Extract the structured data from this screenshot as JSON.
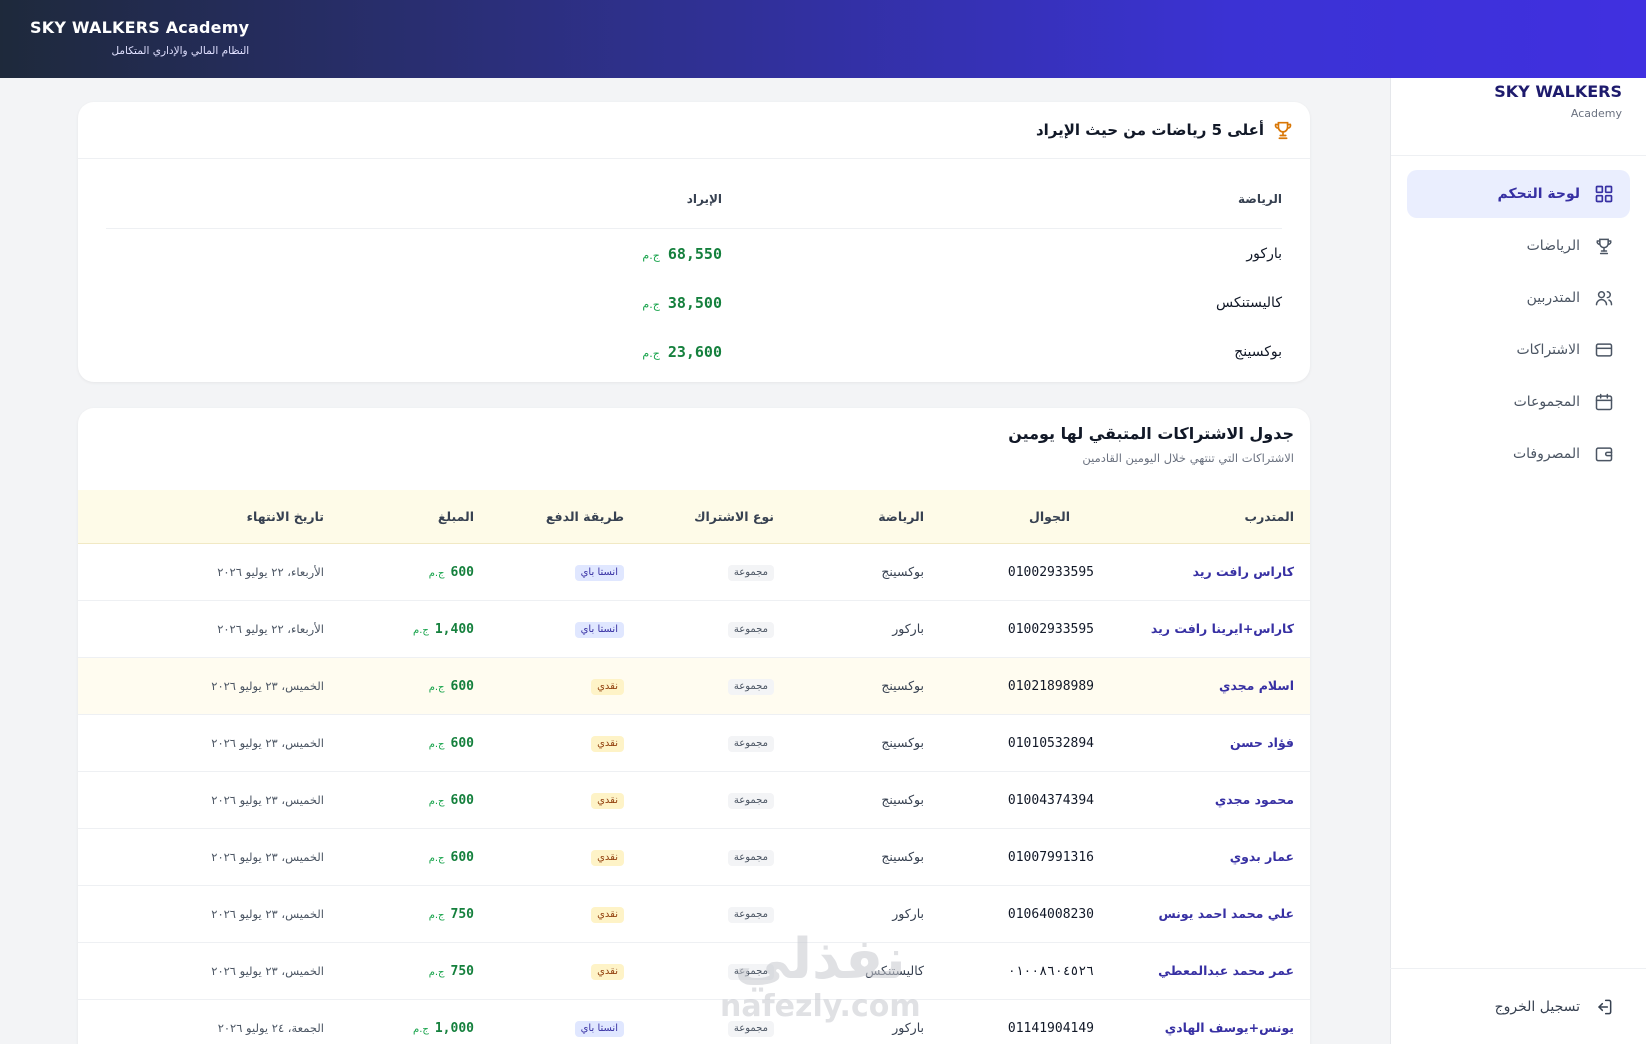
{
  "header": {
    "title": "SKY WALKERS Academy",
    "subtitle": "النظام المالي والإداري المتكامل"
  },
  "sidebar": {
    "brand_title": "SKY WALKERS",
    "brand_sub": "Academy",
    "items": [
      {
        "label": "لوحة التحكم",
        "icon": "grid-icon",
        "active": true
      },
      {
        "label": "الرياضات",
        "icon": "trophy-icon",
        "active": false
      },
      {
        "label": "المتدربين",
        "icon": "users-icon",
        "active": false
      },
      {
        "label": "الاشتراكات",
        "icon": "credit-card-icon",
        "active": false
      },
      {
        "label": "المجموعات",
        "icon": "calendar-icon",
        "active": false
      },
      {
        "label": "المصروفات",
        "icon": "wallet-icon",
        "active": false
      }
    ],
    "logout_label": "تسجيل الخروج"
  },
  "top_sports": {
    "title": "أعلى 5 رياضات من حيث الإيراد",
    "col_sport": "الرياضة",
    "col_revenue": "الإيراد",
    "currency": "ج.م",
    "rows": [
      {
        "sport": "باركور",
        "revenue": "68,550"
      },
      {
        "sport": "كاليستنكس",
        "revenue": "38,500"
      },
      {
        "sport": "بوكسينج",
        "revenue": "23,600"
      }
    ]
  },
  "expiring": {
    "title": "جدول الاشتراكات المتبقي لها يومين",
    "subtitle": "الاشتراكات التي تنتهي خلال اليومين القادمين",
    "columns": {
      "trainee": "المتدرب",
      "phone": "الجوال",
      "sport": "الرياضة",
      "type": "نوع الاشتراك",
      "payment": "طريقة الدفع",
      "amount": "المبلغ",
      "end_date": "تاريخ الانتهاء"
    },
    "currency": "ج.م",
    "rows": [
      {
        "name": "كاراس رافت ريد",
        "phone": "01002933595",
        "sport": "بوكسينج",
        "type": "مجموعة",
        "payment": "انستا باي",
        "amount": "600",
        "date": "الأربعاء، ٢٢ يوليو ٢٠٢٦"
      },
      {
        "name": "كاراس+ايرينا رافت ريد",
        "phone": "01002933595",
        "sport": "باركور",
        "type": "مجموعة",
        "payment": "انستا باي",
        "amount": "1,400",
        "date": "الأربعاء، ٢٢ يوليو ٢٠٢٦"
      },
      {
        "name": "اسلام مجدي",
        "phone": "01021898989",
        "sport": "بوكسينج",
        "type": "مجموعة",
        "payment": "نقدي",
        "amount": "600",
        "date": "الخميس، ٢٣ يوليو ٢٠٢٦"
      },
      {
        "name": "فؤاد حسن",
        "phone": "01010532894",
        "sport": "بوكسينج",
        "type": "مجموعة",
        "payment": "نقدي",
        "amount": "600",
        "date": "الخميس، ٢٣ يوليو ٢٠٢٦"
      },
      {
        "name": "محمود مجدي",
        "phone": "01004374394",
        "sport": "بوكسينج",
        "type": "مجموعة",
        "payment": "نقدي",
        "amount": "600",
        "date": "الخميس، ٢٣ يوليو ٢٠٢٦"
      },
      {
        "name": "عمار بدوي",
        "phone": "01007991316",
        "sport": "بوكسينج",
        "type": "مجموعة",
        "payment": "نقدي",
        "amount": "600",
        "date": "الخميس، ٢٣ يوليو ٢٠٢٦"
      },
      {
        "name": "علي محمد احمد يونس",
        "phone": "01064008230",
        "sport": "باركور",
        "type": "مجموعة",
        "payment": "نقدي",
        "amount": "750",
        "date": "الخميس، ٢٣ يوليو ٢٠٢٦"
      },
      {
        "name": "عمر محمد عبدالمعطي",
        "phone": "٠١٠٠٨٦٠٤٥٢٦",
        "sport": "كاليستنكس",
        "type": "مجموعة",
        "payment": "نقدي",
        "amount": "750",
        "date": "الخميس، ٢٣ يوليو ٢٠٢٦"
      },
      {
        "name": "يونس+يوسف الهادي",
        "phone": "01141904149",
        "sport": "باركور",
        "type": "مجموعة",
        "payment": "انستا باي",
        "amount": "1,000",
        "date": "الجمعة، ٢٤ يوليو ٢٠٢٦"
      }
    ]
  },
  "watermark": {
    "arabic": "نفذلي",
    "latin": "nafezly.com"
  },
  "colors": {
    "primary": "#3730a3",
    "money": "#15803d",
    "header_start": "#1e293b",
    "header_end": "#4030e0"
  }
}
